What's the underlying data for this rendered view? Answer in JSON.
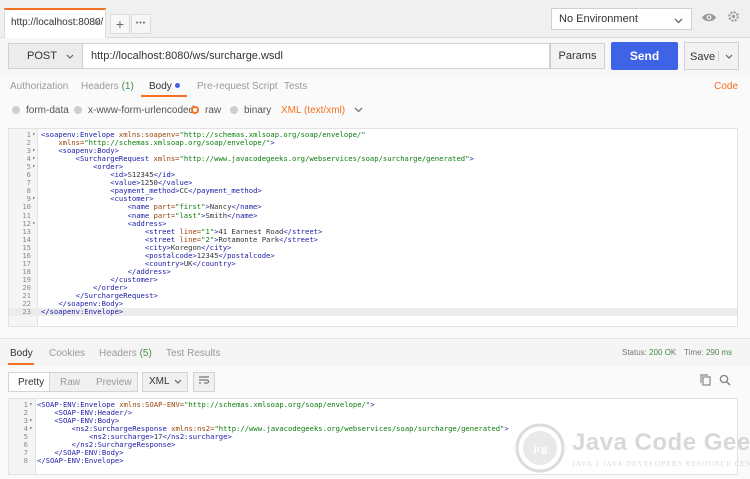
{
  "colors": {
    "accent": "#f47023",
    "send": "#3f63e6",
    "status_ok": "#4a8a4a"
  },
  "tab": {
    "title": "http://localhost:8080/",
    "close": "×",
    "add": "+",
    "more": "•••"
  },
  "environment": {
    "selected": "No Environment"
  },
  "request": {
    "method": "POST",
    "url": "http://localhost:8080/ws/surcharge.wsdl",
    "params_label": "Params",
    "send_label": "Send",
    "save_label": "Save"
  },
  "request_tabs": {
    "authorization": "Authorization",
    "headers": "Headers",
    "headers_count": "(1)",
    "body": "Body",
    "prerequest": "Pre-request Script",
    "tests": "Tests",
    "code": "Code"
  },
  "body_modes": {
    "form_data": "form-data",
    "urlencoded": "x-www-form-urlencoded",
    "raw": "raw",
    "binary": "binary",
    "content_type": "XML (text/xml)"
  },
  "request_body": [
    "<soapenv:Envelope xmlns:soapenv=\"http://schemas.xmlsoap.org/soap/envelope/\"",
    "    xmlns=\"http://schemas.xmlsoap.org/soap/envelope/\">",
    "    <soapenv:Body>",
    "        <SurchargeRequest xmlns=\"http://www.javacodegeeks.org/webservices/soap/surcharge/generated\">",
    "            <order>",
    "                <id>S12345</id>",
    "                <value>1250</value>",
    "                <payment_method>CC</payment_method>",
    "                <customer>",
    "                    <name part=\"first\">Nancy</name>",
    "                    <name part=\"last\">Smith</name>",
    "                    <address>",
    "                        <street line=\"1\">41 Earnest Road</street>",
    "                        <street line=\"2\">Rotamonte Park</street>",
    "                        <city>Koregon</city>",
    "                        <postalcode>12345</postalcode>",
    "                        <country>UK</country>",
    "                    </address>",
    "                </customer>",
    "            </order>",
    "        </SurchargeRequest>",
    "    </soapenv:Body>",
    "</soapenv:Envelope>"
  ],
  "request_body_fold_lines": [
    1,
    3,
    4,
    5,
    9,
    12
  ],
  "response_tabs": {
    "body": "Body",
    "cookies": "Cookies",
    "headers": "Headers",
    "headers_count": "(5)",
    "test_results": "Test Results"
  },
  "response_status": {
    "status_label": "Status:",
    "status_value": "200 OK",
    "time_label": "Time:",
    "time_value": "290 ms"
  },
  "response_view": {
    "pretty": "Pretty",
    "raw": "Raw",
    "preview": "Preview",
    "format": "XML"
  },
  "response_body": [
    "<SOAP-ENV:Envelope xmlns:SOAP-ENV=\"http://schemas.xmlsoap.org/soap/envelope/\">",
    "    <SOAP-ENV:Header/>",
    "    <SOAP-ENV:Body>",
    "        <ns2:SurchargeResponse xmlns:ns2=\"http://www.javacodegeeks.org/webservices/soap/surcharge/generated\">",
    "            <ns2:surcharge>17</ns2:surcharge>",
    "        </ns2:SurchargeResponse>",
    "    </SOAP-ENV:Body>",
    "</SOAP-ENV:Envelope>"
  ],
  "response_body_fold_lines": [
    1,
    3,
    4
  ],
  "watermark": {
    "title": "Java Code Geeks",
    "subtitle": "JAVA 2 JAVA DEVELOPERS RESOURCE CENTER"
  },
  "icons": {
    "eye": "eye-icon",
    "settings": "gear-icon",
    "copy": "copy-icon",
    "search": "search-icon",
    "wrap": "wrap-lines-icon"
  }
}
